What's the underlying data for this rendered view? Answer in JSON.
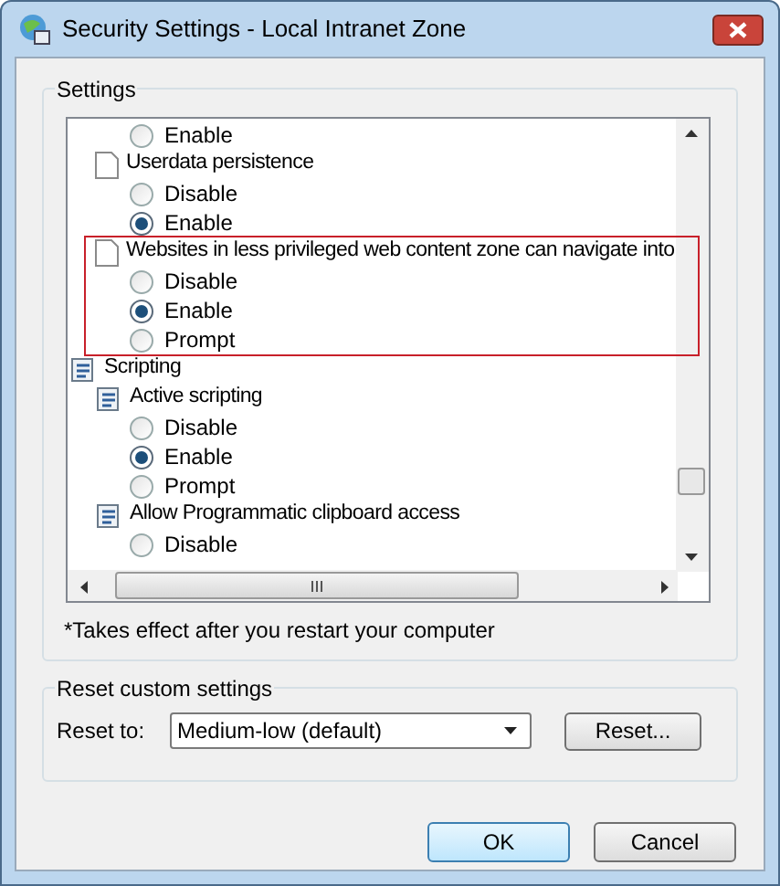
{
  "window": {
    "title": "Security Settings - Local Intranet Zone"
  },
  "settings": {
    "label": "Settings",
    "items": [
      {
        "kind": "option",
        "label": "Enable",
        "selected": false
      },
      {
        "kind": "setting",
        "label": "Userdata persistence",
        "highlighted": false,
        "children": [
          {
            "kind": "option",
            "label": "Disable",
            "selected": false
          },
          {
            "kind": "option",
            "label": "Enable",
            "selected": true
          }
        ]
      },
      {
        "kind": "setting",
        "label": "Websites in less privileged web content zone can navigate into",
        "highlighted": true,
        "children": [
          {
            "kind": "option",
            "label": "Disable",
            "selected": false
          },
          {
            "kind": "option",
            "label": "Enable",
            "selected": true
          },
          {
            "kind": "option",
            "label": "Prompt",
            "selected": false
          }
        ]
      },
      {
        "kind": "category",
        "label": "Scripting",
        "children": [
          {
            "kind": "script",
            "label": "Active scripting",
            "highlighted": false,
            "children": [
              {
                "kind": "option",
                "label": "Disable",
                "selected": false
              },
              {
                "kind": "option",
                "label": "Enable",
                "selected": true
              },
              {
                "kind": "option",
                "label": "Prompt",
                "selected": false
              }
            ]
          },
          {
            "kind": "script",
            "label": "Allow Programmatic clipboard access",
            "highlighted": false,
            "children": [
              {
                "kind": "option",
                "label": "Disable",
                "selected": false
              }
            ]
          }
        ]
      }
    ],
    "note": "*Takes effect after you restart your computer"
  },
  "reset": {
    "label": "Reset custom settings",
    "field_label": "Reset to:",
    "value": "Medium-low (default)",
    "button": "Reset..."
  },
  "buttons": [
    {
      "label": "OK",
      "default": true
    },
    {
      "label": "Cancel",
      "default": false
    }
  ]
}
